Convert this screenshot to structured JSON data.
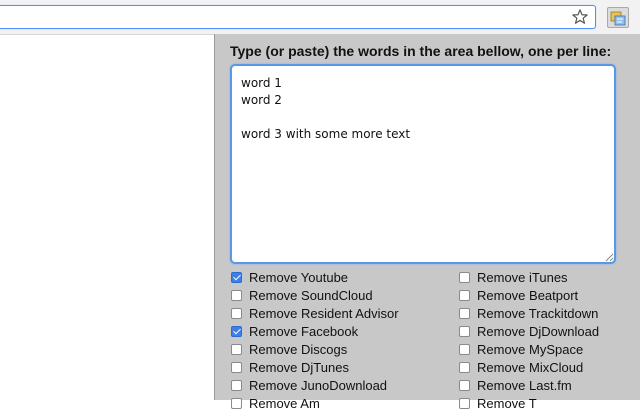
{
  "browser": {
    "bookmark_icon": "star-icon",
    "extension_icon": "extension-icon"
  },
  "popup": {
    "instructions": "Type (or paste) the words in the area bellow, one per line:",
    "words_value": "word 1\nword 2\n\nword 3 with some more text",
    "options_left": [
      {
        "label": "Remove Youtube",
        "checked": true
      },
      {
        "label": "Remove SoundCloud",
        "checked": false
      },
      {
        "label": "Remove Resident Advisor",
        "checked": false
      },
      {
        "label": "Remove Facebook",
        "checked": true
      },
      {
        "label": "Remove Discogs",
        "checked": false
      },
      {
        "label": "Remove DjTunes",
        "checked": false
      },
      {
        "label": "Remove JunoDownload",
        "checked": false
      },
      {
        "label": "Remove Am",
        "checked": false
      }
    ],
    "options_right": [
      {
        "label": "Remove iTunes",
        "checked": false
      },
      {
        "label": "Remove Beatport",
        "checked": false
      },
      {
        "label": "Remove Trackitdown",
        "checked": false
      },
      {
        "label": "Remove DjDownload",
        "checked": false
      },
      {
        "label": "Remove MySpace",
        "checked": false
      },
      {
        "label": "Remove MixCloud",
        "checked": false
      },
      {
        "label": "Remove Last.fm",
        "checked": false
      },
      {
        "label": "Remove T",
        "checked": false
      }
    ],
    "accent_color": "#3d7fe6"
  }
}
